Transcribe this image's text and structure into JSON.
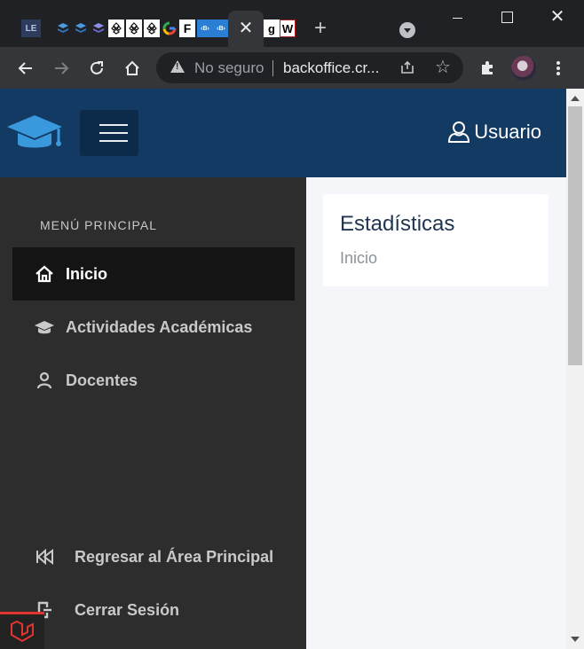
{
  "browser": {
    "tabs_favicons": [
      "le-icon",
      "layers-blue-icon",
      "layers-blue-icon",
      "layers-purple-icon",
      "binance-icon",
      "binance-icon",
      "binance-icon",
      "google-icon",
      "f-icon",
      "blogger-b-icon",
      "blogger-b-icon",
      "g-icon",
      "w-icon"
    ],
    "favicon_texts": {
      "le": "LE",
      "f": "F",
      "g": "g",
      "w": "W"
    },
    "address_bar": {
      "security_label": "No seguro",
      "url": "backoffice.cr..."
    }
  },
  "header": {
    "user_label": "Usuario"
  },
  "sidebar": {
    "heading": "MENÚ PRINCIPAL",
    "items": [
      {
        "label": "Inicio",
        "icon": "home-icon",
        "active": true
      },
      {
        "label": "Actividades Académicas",
        "icon": "graduation-cap-icon",
        "active": false
      },
      {
        "label": "Docentes",
        "icon": "user-icon",
        "active": false
      }
    ],
    "bottom_items": [
      {
        "label": "Regresar al Área Principal",
        "icon": "fast-backward-icon"
      },
      {
        "label": "Cerrar Sesión",
        "icon": "logout-icon"
      }
    ]
  },
  "main": {
    "card_title": "Estadísticas",
    "breadcrumb": "Inicio"
  },
  "colors": {
    "header_bg": "#123a63",
    "sidebar_bg": "#2d2d2d",
    "active_item_bg": "#141414",
    "content_bg": "#f4f6f9"
  }
}
